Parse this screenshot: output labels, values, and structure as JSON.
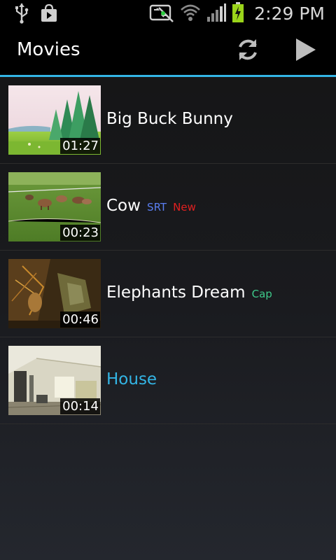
{
  "status_bar": {
    "time": "2:29 PM",
    "icons": [
      "usb-icon",
      "shopping-bag-icon",
      "sync-disabled-icon",
      "wifi-icon",
      "signal-icon",
      "battery-charging-icon"
    ]
  },
  "action_bar": {
    "title": "Movies",
    "actions": [
      {
        "icon": "refresh-icon"
      },
      {
        "icon": "play-icon"
      }
    ]
  },
  "colors": {
    "accent": "#33b5e5",
    "tag_srt": "#5a7ef0",
    "tag_new": "#e02020",
    "tag_cap": "#3ec98a"
  },
  "movies": [
    {
      "title": "Big Buck Bunny",
      "duration": "01:27",
      "tags": [],
      "selected": false,
      "thumbnail": "meadow-with-trees"
    },
    {
      "title": "Cow",
      "duration": "00:23",
      "tags": [
        "SRT",
        "New"
      ],
      "selected": false,
      "thumbnail": "cows-grazing-in-field"
    },
    {
      "title": "Elephants Dream",
      "duration": "00:46",
      "tags": [
        "Cap"
      ],
      "selected": false,
      "thumbnail": "dark-machinery-scene"
    },
    {
      "title": "House",
      "duration": "00:14",
      "tags": [],
      "selected": true,
      "thumbnail": "attic-room-interior"
    }
  ]
}
